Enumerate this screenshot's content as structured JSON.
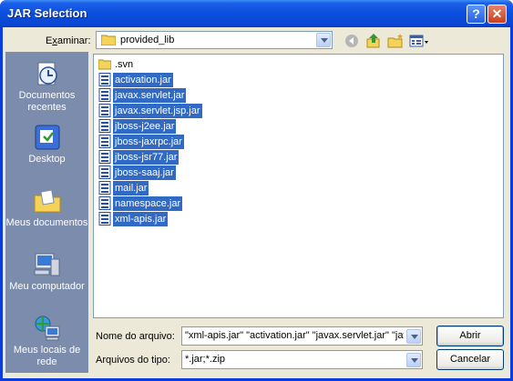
{
  "window": {
    "title": "JAR Selection"
  },
  "titlebar_buttons": {
    "help": "?",
    "close": "✕"
  },
  "lookin": {
    "label_u": "x",
    "label_pre": "E",
    "label_post": "aminar:",
    "value": "provided_lib"
  },
  "places": [
    {
      "label": "Documentos recentes",
      "icon": "recent-documents-icon"
    },
    {
      "label": "Desktop",
      "icon": "desktop-icon"
    },
    {
      "label": "Meus documentos",
      "icon": "my-documents-icon"
    },
    {
      "label": "Meu computador",
      "icon": "my-computer-icon"
    },
    {
      "label": "Meus locais de rede",
      "icon": "network-places-icon"
    }
  ],
  "files": [
    {
      "name": ".svn",
      "type": "folder",
      "selected": false
    },
    {
      "name": "activation.jar",
      "type": "jar",
      "selected": true
    },
    {
      "name": "javax.servlet.jar",
      "type": "jar",
      "selected": true
    },
    {
      "name": "javax.servlet.jsp.jar",
      "type": "jar",
      "selected": true
    },
    {
      "name": "jboss-j2ee.jar",
      "type": "jar",
      "selected": true
    },
    {
      "name": "jboss-jaxrpc.jar",
      "type": "jar",
      "selected": true
    },
    {
      "name": "jboss-jsr77.jar",
      "type": "jar",
      "selected": true
    },
    {
      "name": "jboss-saaj.jar",
      "type": "jar",
      "selected": true
    },
    {
      "name": "mail.jar",
      "type": "jar",
      "selected": true
    },
    {
      "name": "namespace.jar",
      "type": "jar",
      "selected": true
    },
    {
      "name": "xml-apis.jar",
      "type": "jar",
      "selected": true
    }
  ],
  "filename": {
    "label": "Nome do arquivo:",
    "value": "\"xml-apis.jar\" \"activation.jar\" \"javax.servlet.jar\" \"jav"
  },
  "filetype": {
    "label": "Arquivos do tipo:",
    "value": "*.jar;*.zip"
  },
  "buttons": {
    "open": "Abrir",
    "cancel": "Cancelar"
  },
  "colors": {
    "selection": "#316ac5",
    "places_bar": "#7b8cac",
    "titlebar": "#0a4fdc"
  }
}
